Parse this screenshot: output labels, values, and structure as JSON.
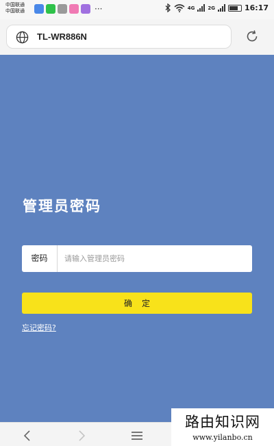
{
  "status_bar": {
    "carriers": [
      "中国联通",
      "中国联通"
    ],
    "network_labels": [
      "4G",
      "2G"
    ],
    "time": "16:17",
    "more": "···",
    "app_colors": [
      "#4a88e8",
      "#2fc24a",
      "#9a9a9a",
      "#f07ab4",
      "#a070e0"
    ]
  },
  "browser": {
    "url": "TL-WR886N"
  },
  "page": {
    "title": "管理员密码",
    "password_label": "密码",
    "password_placeholder": "请输入管理员密码",
    "confirm_button": "确定",
    "forgot_link": "忘记密码?"
  },
  "watermark": {
    "title": "路由知识网",
    "url": "www.yilanbo.cn"
  },
  "colors": {
    "background": "#5e82bf",
    "button": "#f8e21a"
  }
}
